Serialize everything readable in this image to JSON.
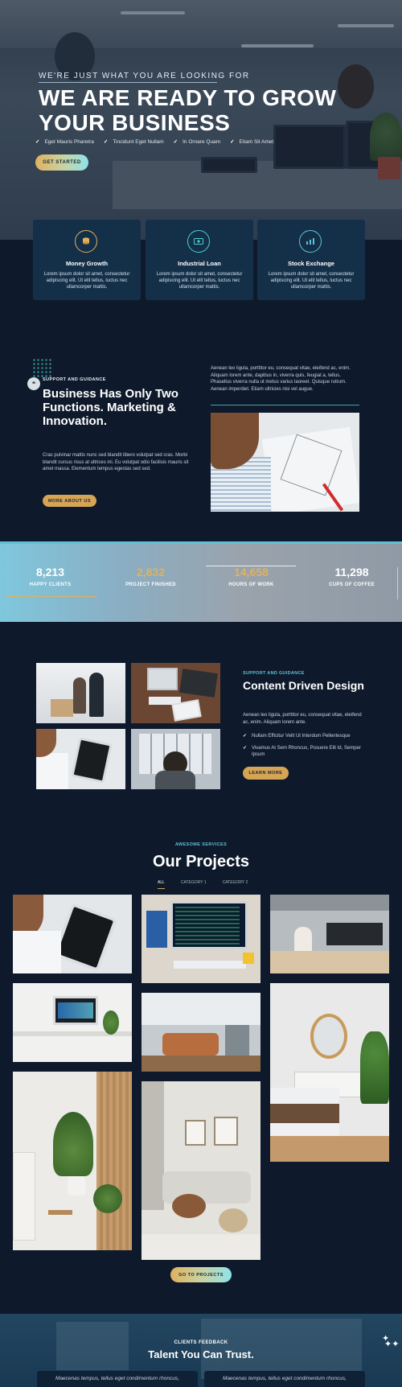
{
  "hero": {
    "eyebrow": "WE'RE JUST WHAT YOU ARE LOOKING FOR",
    "title": "WE ARE READY TO GROW YOUR BUSINESS",
    "checks": [
      "Eget Mauris Pharetra",
      "Tincidunt Eget Nullam",
      "In Ornare Quam",
      "Etiam Sit Amet"
    ],
    "cta": "GET STARTED"
  },
  "features": [
    {
      "icon": "coins-icon",
      "title": "Money Growth",
      "text": "Lorem ipsum dolor sit amet, consectetur adipiscing elit. Ut elit tellus, luctus nec ullamcorper mattis.",
      "color": "#e0b25e"
    },
    {
      "icon": "money-bill-icon",
      "title": "Industrial Loan",
      "text": "Lorem ipsum dolor sit amet, consectetur adipiscing elit. Ut elit tellus, luctus nec ullamcorper mattis.",
      "color": "#4fd0c8"
    },
    {
      "icon": "chart-icon",
      "title": "Stock Exchange",
      "text": "Lorem ipsum dolor sit amet, consectetur adipiscing elit. Ut elit tellus, luctus nec ullamcorper mattis.",
      "color": "#5fc0d9"
    }
  ],
  "about": {
    "eyebrow": "SUPPORT AND GUIDANCE",
    "title": "Business Has Only Two Functions. Marketing & Innovation.",
    "text": "Cras pulvinar mattis nunc sed blandit libero volutpat sed cras. Morbi blandit cursus risus at ultrices mi. Eu volutpat odio facilisis mauris sit amet massa. Elementum tempus egestas sed sed.",
    "button": "MORE ABOUT US",
    "right_text": "Aenean leo ligula, porttitor eu, consequat vitae, eleifend ac, enim. Aliquam lorem ante, dapibus in, viverra quis, feugiat a, tellus. Phasellus viverra nulla ut metus varius laoreet. Quisque rutrum. Aenean imperdiet. Etiam ultricies nisi vel augue."
  },
  "stats": [
    {
      "value": "8,213",
      "label": "HAPPY CLIENTS",
      "color": "#ffffff"
    },
    {
      "value": "2,832",
      "label": "PROJECT FINISHED",
      "color": "#e0b25e"
    },
    {
      "value": "14,658",
      "label": "HOURS OF WORK",
      "color": "#e0b25e"
    },
    {
      "value": "11,298",
      "label": "CUPS OF COFFEE",
      "color": "#ffffff"
    }
  ],
  "content": {
    "eyebrow": "SUPPORT AND GUIDANCE",
    "title": "Content Driven Design",
    "text": "Aenean leo ligula, porttitor eu, consequat vitae, eleifend ac, enim. Aliquam lorem ante.",
    "list": [
      "Nullam Efficitur Velit Ut Interdum Pellentesque",
      "Vivamus At Sem Rhoncus, Posuere Elit Id, Semper Ipsum"
    ],
    "button": "LEARN MORE"
  },
  "projects": {
    "eyebrow": "AWESOME SERVICES",
    "title": "Our Projects",
    "tabs": [
      "ALL",
      "CATEGORY 1",
      "CATEGORY 2"
    ],
    "button": "GO TO PROJECTS"
  },
  "feedback": {
    "eyebrow": "CLIENTS FEEDBACK",
    "title": "Talent You Can Trust.",
    "quotes": [
      "Maecenas tempus, tellus eget condimentum rhoncus,",
      "Maecenas tempus, tellus eget condimentum rhoncus,"
    ]
  }
}
